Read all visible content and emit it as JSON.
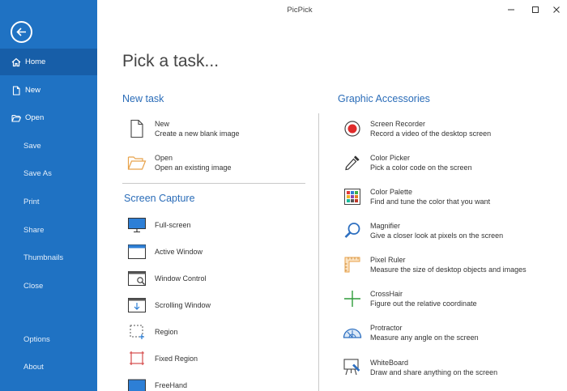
{
  "window": {
    "title": "PicPick"
  },
  "sidebar": {
    "items": [
      {
        "label": "Home",
        "icon": "home-icon"
      },
      {
        "label": "New",
        "icon": "new-file-icon"
      },
      {
        "label": "Open",
        "icon": "folder-open-icon"
      },
      {
        "label": "Save"
      },
      {
        "label": "Save As"
      },
      {
        "label": "Print"
      },
      {
        "label": "Share"
      },
      {
        "label": "Thumbnails"
      },
      {
        "label": "Close"
      },
      {
        "label": "Options"
      },
      {
        "label": "About"
      }
    ]
  },
  "main": {
    "title": "Pick a task...",
    "new_task": {
      "heading": "New task",
      "items": [
        {
          "name": "New",
          "desc": "Create a new blank image",
          "icon": "blank-page-icon"
        },
        {
          "name": "Open",
          "desc": "Open an existing image",
          "icon": "folder-icon"
        }
      ]
    },
    "screen_capture": {
      "heading": "Screen Capture",
      "items": [
        {
          "name": "Full-screen",
          "icon": "monitor-icon"
        },
        {
          "name": "Active Window",
          "icon": "window-icon"
        },
        {
          "name": "Window Control",
          "icon": "window-control-icon"
        },
        {
          "name": "Scrolling Window",
          "icon": "scrolling-window-icon"
        },
        {
          "name": "Region",
          "icon": "region-icon"
        },
        {
          "name": "Fixed Region",
          "icon": "fixed-region-icon"
        },
        {
          "name": "FreeHand",
          "icon": "freehand-icon"
        }
      ]
    },
    "graphic_accessories": {
      "heading": "Graphic Accessories",
      "items": [
        {
          "name": "Screen Recorder",
          "desc": "Record a video of the desktop screen",
          "icon": "record-icon"
        },
        {
          "name": "Color Picker",
          "desc": "Pick a color code on the screen",
          "icon": "eyedropper-icon"
        },
        {
          "name": "Color Palette",
          "desc": "Find and tune the color that you want",
          "icon": "palette-icon"
        },
        {
          "name": "Magnifier",
          "desc": "Give a closer look at pixels on the screen",
          "icon": "magnifier-icon"
        },
        {
          "name": "Pixel Ruler",
          "desc": "Measure the size of desktop objects and images",
          "icon": "ruler-icon"
        },
        {
          "name": "CrossHair",
          "desc": "Figure out the relative coordinate",
          "icon": "crosshair-icon"
        },
        {
          "name": "Protractor",
          "desc": "Measure any angle on the screen",
          "icon": "protractor-icon"
        },
        {
          "name": "WhiteBoard",
          "desc": "Draw and share anything on the screen",
          "icon": "whiteboard-icon"
        }
      ]
    }
  },
  "colors": {
    "sidebar": "#1f72c3",
    "sidebar_active": "#175ea8",
    "accent": "#2a6cb8"
  }
}
